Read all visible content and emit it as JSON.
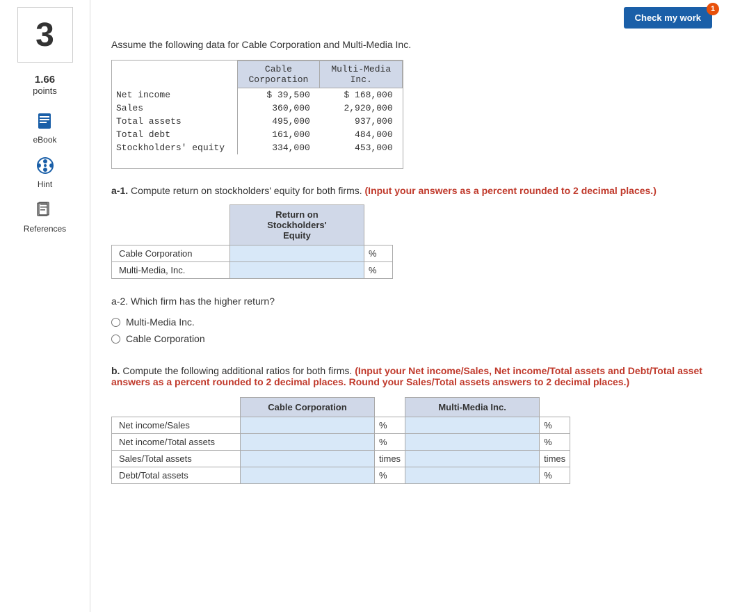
{
  "page": {
    "question_number": "3",
    "points_value": "1.66",
    "points_label": "points"
  },
  "sidebar": {
    "ebook_label": "eBook",
    "hint_label": "Hint",
    "references_label": "References"
  },
  "header": {
    "check_button_label": "Check my work",
    "badge_value": "1"
  },
  "intro": {
    "text": "Assume the following data for Cable Corporation and Multi-Media Inc."
  },
  "data_table": {
    "col1_header": "Cable\nCorporation",
    "col2_header": "Multi-Media\nInc.",
    "rows": [
      {
        "label": "Net income",
        "col1": "$  39,500",
        "col2": "$   168,000"
      },
      {
        "label": "Sales",
        "col1": "360,000",
        "col2": "2,920,000"
      },
      {
        "label": "Total assets",
        "col1": "495,000",
        "col2": "937,000"
      },
      {
        "label": "Total debt",
        "col1": "161,000",
        "col2": "484,000"
      },
      {
        "label": "Stockholders' equity",
        "col1": "334,000",
        "col2": "453,000"
      }
    ]
  },
  "a1": {
    "label_bold": "a-1.",
    "label_text": " Compute return on stockholders' equity for both firms.",
    "label_colored": " (Input your answers as a percent rounded to 2 decimal places.)",
    "table_header": "Return on\nStockholders'\nEquity",
    "rows": [
      {
        "label": "Cable Corporation",
        "unit": "%"
      },
      {
        "label": "Multi-Media, Inc.",
        "unit": "%"
      }
    ]
  },
  "a2": {
    "label_bold": "a-2.",
    "label_text": " Which firm has the higher return?",
    "options": [
      {
        "label": "Multi-Media Inc.",
        "value": "multi-media"
      },
      {
        "label": "Cable Corporation",
        "value": "cable"
      }
    ]
  },
  "b": {
    "label_bold": "b.",
    "label_text": " Compute the following additional ratios for both firms.",
    "label_colored": " (Input your Net income/Sales, Net income/Total assets and Debt/Total asset answers as a percent rounded to 2 decimal places. Round your Sales/Total assets answers to 2 decimal places.)",
    "col1_header": "Cable Corporation",
    "col2_header": "Multi-Media Inc.",
    "rows": [
      {
        "label": "Net income/Sales",
        "unit1": "%",
        "unit2": "%"
      },
      {
        "label": "Net income/Total assets",
        "unit1": "%",
        "unit2": "%"
      },
      {
        "label": "Sales/Total assets",
        "unit1": "times",
        "unit2": "times"
      },
      {
        "label": "Debt/Total assets",
        "unit1": "%",
        "unit2": "%"
      }
    ]
  }
}
